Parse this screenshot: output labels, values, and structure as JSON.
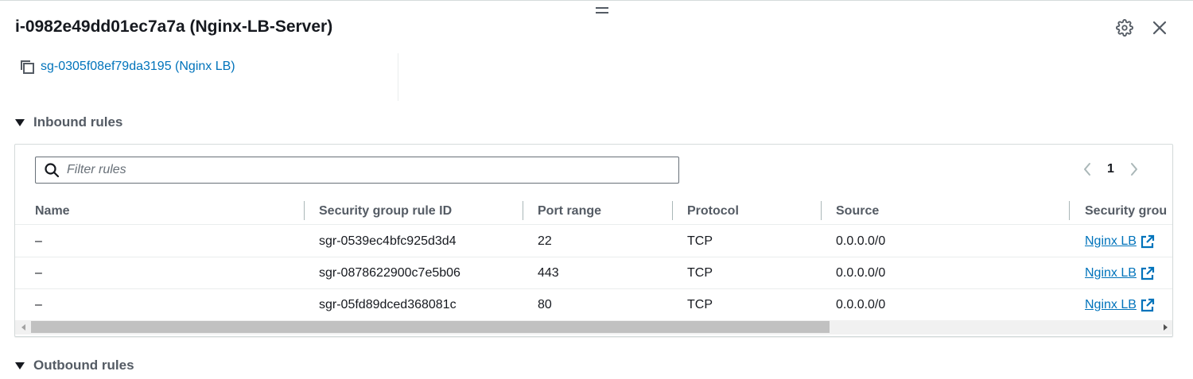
{
  "panel": {
    "title": "i-0982e49dd01ec7a7a (Nginx-LB-Server)",
    "icons": {
      "settings": "gear-icon",
      "close": "close-icon",
      "drag": "drag-handle-icon"
    }
  },
  "security_group": {
    "link_label": "sg-0305f08ef79da3195 (Nginx LB)",
    "copy_icon": "copy-icon"
  },
  "inbound": {
    "title": "Inbound rules",
    "filter": {
      "placeholder": "Filter rules",
      "value": ""
    },
    "pagination": {
      "current_page": "1"
    },
    "columns": [
      "Name",
      "Security group rule ID",
      "Port range",
      "Protocol",
      "Source",
      "Security grou"
    ],
    "rows": [
      {
        "name": "–",
        "rule_id": "sgr-0539ec4bfc925d3d4",
        "port": "22",
        "protocol": "TCP",
        "source": "0.0.0.0/0",
        "security_group": "Nginx LB"
      },
      {
        "name": "–",
        "rule_id": "sgr-0878622900c7e5b06",
        "port": "443",
        "protocol": "TCP",
        "source": "0.0.0.0/0",
        "security_group": "Nginx LB"
      },
      {
        "name": "–",
        "rule_id": "sgr-05fd89dced368081c",
        "port": "80",
        "protocol": "TCP",
        "source": "0.0.0.0/0",
        "security_group": "Nginx LB"
      }
    ]
  },
  "outbound": {
    "title": "Outbound rules"
  },
  "colors": {
    "link": "#0073bb",
    "text": "#16191f",
    "muted": "#545b64",
    "border": "#d5dbdb"
  }
}
